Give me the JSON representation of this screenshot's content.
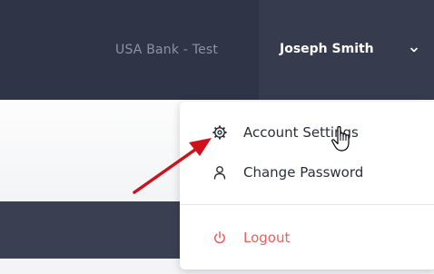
{
  "header": {
    "bank_name": "USA Bank - Test",
    "user_name": "Joseph Smith",
    "dropdown_icon": "chevron-down-icon"
  },
  "user_menu": {
    "items": [
      {
        "label": "Account Settings",
        "icon": "gear-icon"
      },
      {
        "label": "Change Password",
        "icon": "user-icon"
      },
      {
        "label": "Logout",
        "icon": "power-icon",
        "color": "#f25c5c"
      }
    ]
  },
  "colors": {
    "header_bg": "#2f3546",
    "user_area_bg": "#363c4d",
    "logout": "#f25c5c",
    "annotation_arrow": "#d0111b"
  }
}
